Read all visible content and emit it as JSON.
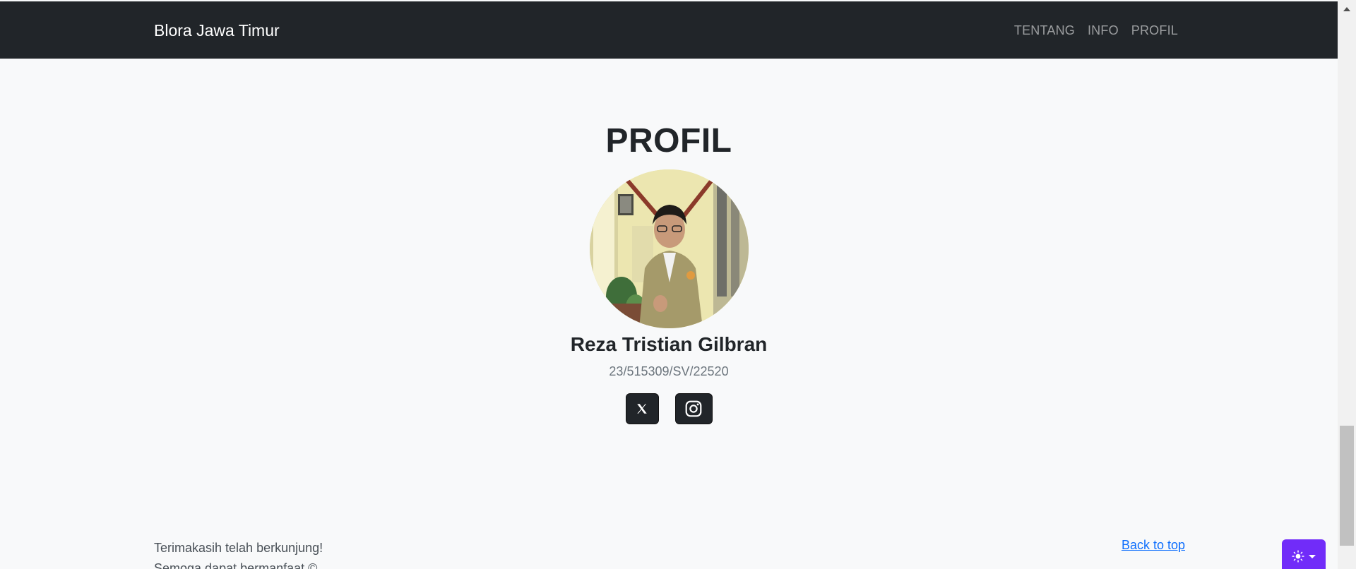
{
  "navbar": {
    "brand": "Blora Jawa Timur",
    "links": [
      "TENTANG",
      "INFO",
      "PROFIL"
    ]
  },
  "profile": {
    "heading": "PROFIL",
    "name": "Reza Tristian Gilbran",
    "nim": "23/515309/SV/22520",
    "socials": [
      {
        "icon": "x-twitter-icon"
      },
      {
        "icon": "instagram-icon"
      }
    ]
  },
  "footer": {
    "lines": [
      "Terimakasih telah berkunjung!",
      "Semoga dapat bermanfaat ©"
    ],
    "back_to_top": "Back to top"
  },
  "theme_toggle": {
    "icon": "sun-icon"
  },
  "colors": {
    "navbar_bg": "#212529",
    "page_bg": "#f8f9fa",
    "link": "#0d6efd",
    "toggle_bg": "#712cf9"
  }
}
